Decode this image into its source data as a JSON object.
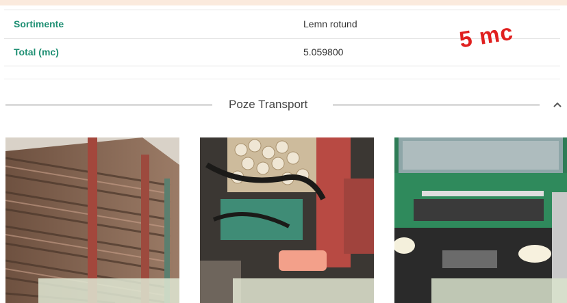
{
  "details": {
    "rows": [
      {
        "label": "Sortimente",
        "value": "Lemn rotund"
      },
      {
        "label": "Total (mc)",
        "value": "5.059800"
      }
    ],
    "annotation": "5 mc"
  },
  "section": {
    "title": "Poze Transport",
    "toggle_icon": "chevron-up-icon"
  },
  "photos": [
    {
      "subject": "log-load-side-photo"
    },
    {
      "subject": "crane-and-logs-photo"
    },
    {
      "subject": "green-truck-front-photo"
    }
  ],
  "colors": {
    "label": "#1e8f73",
    "annotation": "#e0201f",
    "truck": "#2f8a5c"
  }
}
